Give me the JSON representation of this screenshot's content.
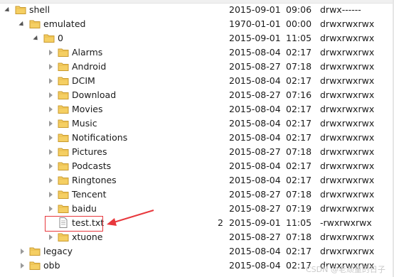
{
  "tree": [
    {
      "name": "shell",
      "date": "2015-09-01",
      "time": "09:06",
      "perm": "drwx------",
      "size": "",
      "depth": 0,
      "kind": "folder",
      "expanded": true
    },
    {
      "name": "emulated",
      "date": "1970-01-01",
      "time": "00:00",
      "perm": "drwxrwxrwx",
      "size": "",
      "depth": 1,
      "kind": "folder",
      "expanded": true
    },
    {
      "name": "0",
      "date": "2015-09-01",
      "time": "11:05",
      "perm": "drwxrwxrwx",
      "size": "",
      "depth": 2,
      "kind": "folder",
      "expanded": true
    },
    {
      "name": "Alarms",
      "date": "2015-08-04",
      "time": "02:17",
      "perm": "drwxrwxrwx",
      "size": "",
      "depth": 3,
      "kind": "folder",
      "expanded": false
    },
    {
      "name": "Android",
      "date": "2015-08-27",
      "time": "07:18",
      "perm": "drwxrwxrwx",
      "size": "",
      "depth": 3,
      "kind": "folder",
      "expanded": false
    },
    {
      "name": "DCIM",
      "date": "2015-08-04",
      "time": "02:17",
      "perm": "drwxrwxrwx",
      "size": "",
      "depth": 3,
      "kind": "folder",
      "expanded": false
    },
    {
      "name": "Download",
      "date": "2015-08-27",
      "time": "07:16",
      "perm": "drwxrwxrwx",
      "size": "",
      "depth": 3,
      "kind": "folder",
      "expanded": false
    },
    {
      "name": "Movies",
      "date": "2015-08-04",
      "time": "02:17",
      "perm": "drwxrwxrwx",
      "size": "",
      "depth": 3,
      "kind": "folder",
      "expanded": false
    },
    {
      "name": "Music",
      "date": "2015-08-04",
      "time": "02:17",
      "perm": "drwxrwxrwx",
      "size": "",
      "depth": 3,
      "kind": "folder",
      "expanded": false
    },
    {
      "name": "Notifications",
      "date": "2015-08-04",
      "time": "02:17",
      "perm": "drwxrwxrwx",
      "size": "",
      "depth": 3,
      "kind": "folder",
      "expanded": false
    },
    {
      "name": "Pictures",
      "date": "2015-08-27",
      "time": "07:18",
      "perm": "drwxrwxrwx",
      "size": "",
      "depth": 3,
      "kind": "folder",
      "expanded": false
    },
    {
      "name": "Podcasts",
      "date": "2015-08-04",
      "time": "02:17",
      "perm": "drwxrwxrwx",
      "size": "",
      "depth": 3,
      "kind": "folder",
      "expanded": false
    },
    {
      "name": "Ringtones",
      "date": "2015-08-04",
      "time": "02:17",
      "perm": "drwxrwxrwx",
      "size": "",
      "depth": 3,
      "kind": "folder",
      "expanded": false
    },
    {
      "name": "Tencent",
      "date": "2015-08-27",
      "time": "07:18",
      "perm": "drwxrwxrwx",
      "size": "",
      "depth": 3,
      "kind": "folder",
      "expanded": false
    },
    {
      "name": "baidu",
      "date": "2015-08-27",
      "time": "07:19",
      "perm": "drwxrwxrwx",
      "size": "",
      "depth": 3,
      "kind": "folder",
      "expanded": false
    },
    {
      "name": "test.txt",
      "date": "2015-09-01",
      "time": "11:05",
      "perm": "-rwxrwxrwx",
      "size": "2",
      "depth": 3,
      "kind": "file",
      "expanded": false
    },
    {
      "name": "xtuone",
      "date": "2015-08-27",
      "time": "07:18",
      "perm": "drwxrwxrwx",
      "size": "",
      "depth": 3,
      "kind": "folder",
      "expanded": false
    },
    {
      "name": "legacy",
      "date": "2015-08-04",
      "time": "02:17",
      "perm": "drwxrwxrwx",
      "size": "",
      "depth": 1,
      "kind": "folder",
      "expanded": false
    },
    {
      "name": "obb",
      "date": "2015-08-04",
      "time": "02:17",
      "perm": "drwxrwxrwx",
      "size": "",
      "depth": 1,
      "kind": "folder",
      "expanded": false
    }
  ],
  "icons": {
    "folder": "folder-icon",
    "file": "text-file-icon",
    "expand_open": "expanded-triangle-icon",
    "expand_closed": "collapsed-triangle-icon"
  },
  "colors": {
    "folder_fill": "#f5cf63",
    "folder_stroke": "#c99a2e",
    "annotation": "#e8383d",
    "watermark": "#c9c9c9"
  },
  "watermark": "CSDN @老顽童的日子"
}
